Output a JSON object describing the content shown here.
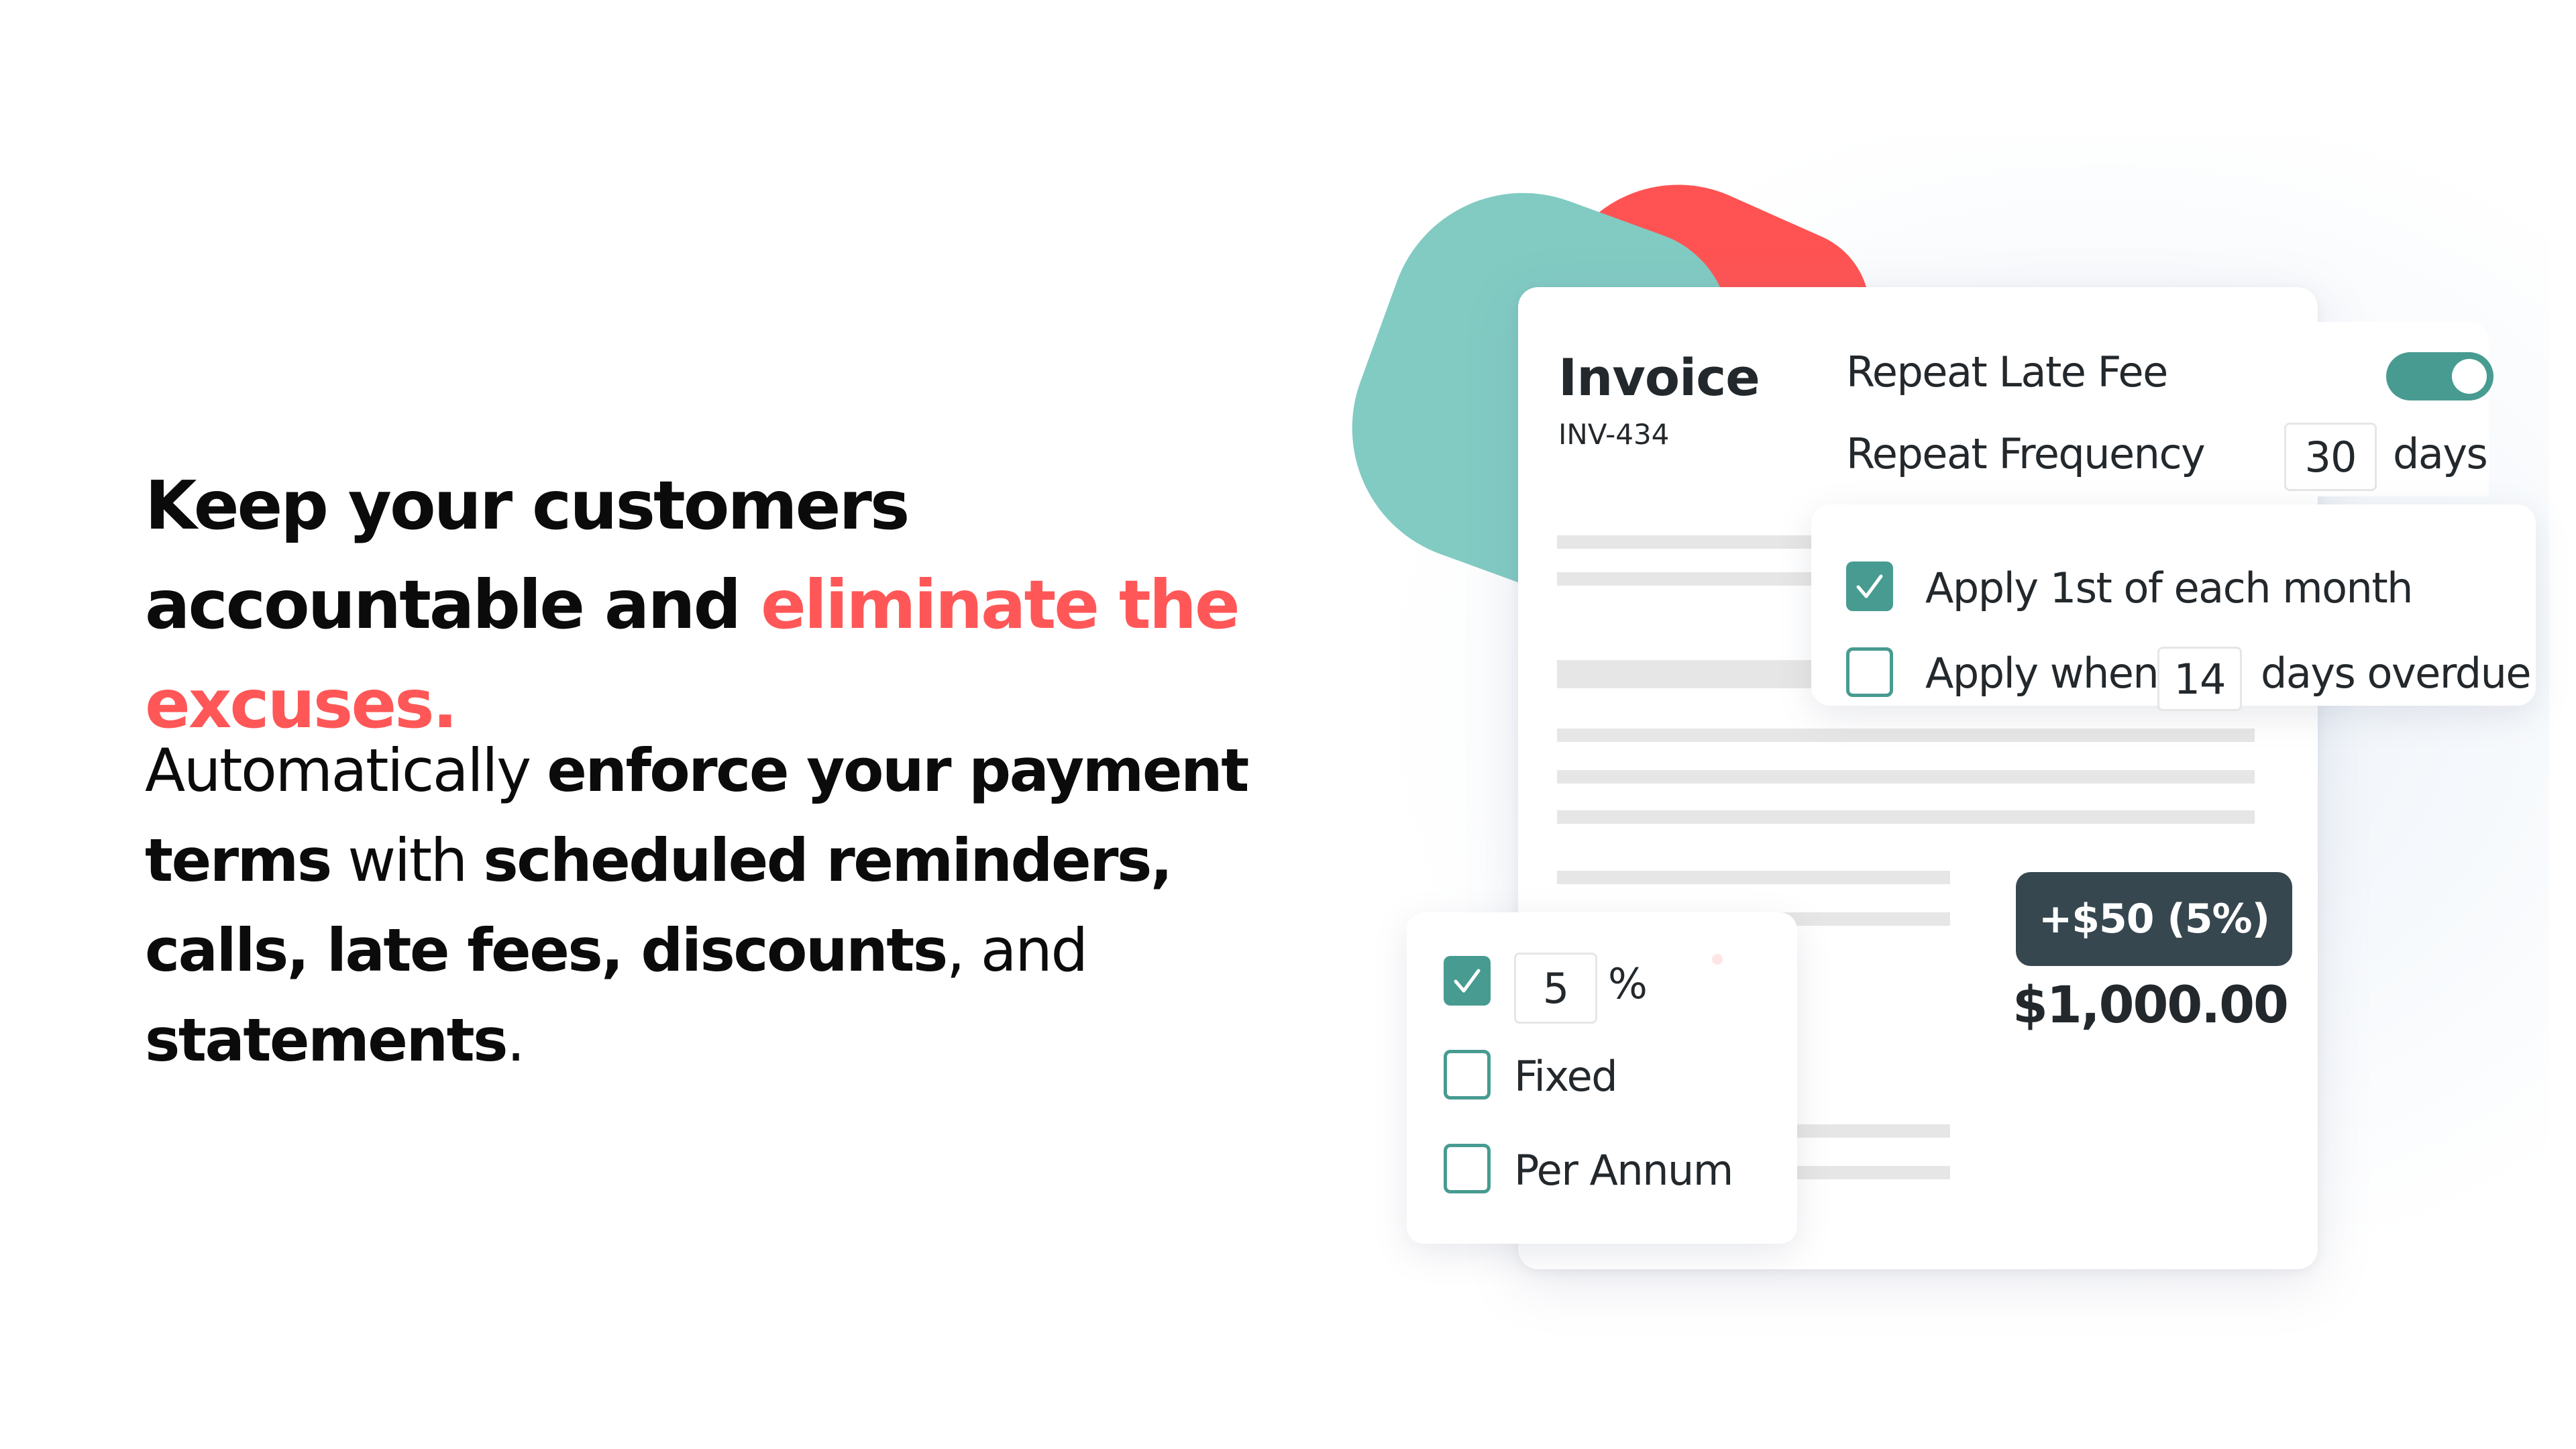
{
  "marketing": {
    "headline_part1": "Keep your customers accountable and ",
    "headline_accent": "eliminate the excuses.",
    "body": [
      {
        "text": "Automatically ",
        "bold": false
      },
      {
        "text": "enforce your payment terms",
        "bold": true
      },
      {
        "text": " with ",
        "bold": false
      },
      {
        "text": "scheduled reminders, calls, late fees, discounts",
        "bold": true
      },
      {
        "text": ", and ",
        "bold": false
      },
      {
        "text": "statements",
        "bold": true
      },
      {
        "text": ".",
        "bold": false
      }
    ]
  },
  "invoice": {
    "title": "Invoice",
    "number": "INV-434",
    "fee_badge": "+$50 (5%)",
    "total": "$1,000.00"
  },
  "repeat_settings": {
    "repeat_late_fee_label": "Repeat Late Fee",
    "repeat_late_fee_enabled": true,
    "repeat_frequency_label": "Repeat Frequency",
    "repeat_frequency_value": "30",
    "repeat_frequency_unit": "days",
    "options": [
      {
        "label": "Apply 1st of each month",
        "checked": true
      },
      {
        "label_before": "Apply when",
        "value": "14",
        "label_after": "days overdue",
        "checked": false
      }
    ]
  },
  "fee_type": {
    "options": [
      {
        "value": "5",
        "unit": "%",
        "checked": true
      },
      {
        "label": "Fixed",
        "checked": false
      },
      {
        "label": "Per Annum",
        "checked": false
      }
    ]
  },
  "colors": {
    "accent_red": "#ff5757",
    "teal": "#479b91",
    "teal_light": "#81cbc3",
    "badge_dark": "#37474f"
  }
}
